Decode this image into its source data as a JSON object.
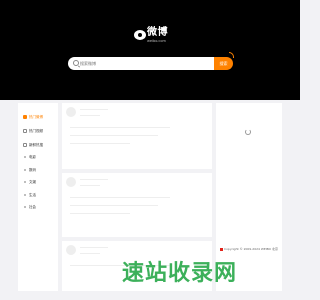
{
  "header": {
    "logo_text": "微博",
    "logo_sub": "weibo.com",
    "search_placeholder": "搜索微博",
    "search_button": "搜索"
  },
  "sidebar": {
    "items": [
      {
        "label": "热门微博",
        "icon": "fire-icon",
        "active": true
      },
      {
        "label": "热门视频",
        "icon": "video-icon",
        "active": false
      },
      {
        "label": "新鲜热搜",
        "icon": "hot-search-icon",
        "active": false
      },
      {
        "label": "电影",
        "icon": "dot-icon",
        "active": false
      },
      {
        "label": "数码",
        "icon": "dot-icon",
        "active": false
      },
      {
        "label": "文娱",
        "icon": "dot-icon",
        "active": false
      },
      {
        "label": "生活",
        "icon": "dot-icon",
        "active": false
      },
      {
        "label": "社会",
        "icon": "dot-icon",
        "active": false
      }
    ]
  },
  "right_panel": {
    "copyright": "Copyright © 2009-2024 WEIBO 北京"
  },
  "watermark": {
    "text": "速站收录网"
  },
  "colors": {
    "accent": "#ff8200",
    "header_bg": "#000000",
    "page_bg": "#f2f2f5",
    "watermark": "#3cb05a"
  }
}
